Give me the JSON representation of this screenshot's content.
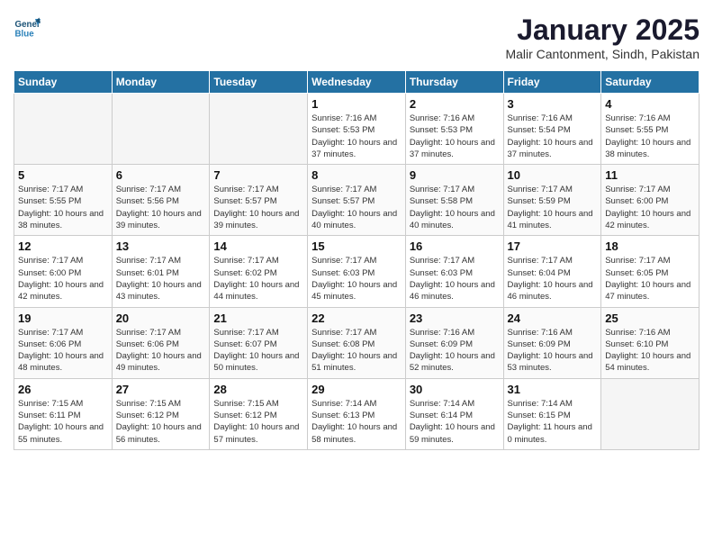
{
  "header": {
    "logo_line1": "General",
    "logo_line2": "Blue",
    "month": "January 2025",
    "location": "Malir Cantonment, Sindh, Pakistan"
  },
  "weekdays": [
    "Sunday",
    "Monday",
    "Tuesday",
    "Wednesday",
    "Thursday",
    "Friday",
    "Saturday"
  ],
  "weeks": [
    [
      {
        "day": "",
        "sunrise": "",
        "sunset": "",
        "daylight": ""
      },
      {
        "day": "",
        "sunrise": "",
        "sunset": "",
        "daylight": ""
      },
      {
        "day": "",
        "sunrise": "",
        "sunset": "",
        "daylight": ""
      },
      {
        "day": "1",
        "sunrise": "Sunrise: 7:16 AM",
        "sunset": "Sunset: 5:53 PM",
        "daylight": "Daylight: 10 hours and 37 minutes."
      },
      {
        "day": "2",
        "sunrise": "Sunrise: 7:16 AM",
        "sunset": "Sunset: 5:53 PM",
        "daylight": "Daylight: 10 hours and 37 minutes."
      },
      {
        "day": "3",
        "sunrise": "Sunrise: 7:16 AM",
        "sunset": "Sunset: 5:54 PM",
        "daylight": "Daylight: 10 hours and 37 minutes."
      },
      {
        "day": "4",
        "sunrise": "Sunrise: 7:16 AM",
        "sunset": "Sunset: 5:55 PM",
        "daylight": "Daylight: 10 hours and 38 minutes."
      }
    ],
    [
      {
        "day": "5",
        "sunrise": "Sunrise: 7:17 AM",
        "sunset": "Sunset: 5:55 PM",
        "daylight": "Daylight: 10 hours and 38 minutes."
      },
      {
        "day": "6",
        "sunrise": "Sunrise: 7:17 AM",
        "sunset": "Sunset: 5:56 PM",
        "daylight": "Daylight: 10 hours and 39 minutes."
      },
      {
        "day": "7",
        "sunrise": "Sunrise: 7:17 AM",
        "sunset": "Sunset: 5:57 PM",
        "daylight": "Daylight: 10 hours and 39 minutes."
      },
      {
        "day": "8",
        "sunrise": "Sunrise: 7:17 AM",
        "sunset": "Sunset: 5:57 PM",
        "daylight": "Daylight: 10 hours and 40 minutes."
      },
      {
        "day": "9",
        "sunrise": "Sunrise: 7:17 AM",
        "sunset": "Sunset: 5:58 PM",
        "daylight": "Daylight: 10 hours and 40 minutes."
      },
      {
        "day": "10",
        "sunrise": "Sunrise: 7:17 AM",
        "sunset": "Sunset: 5:59 PM",
        "daylight": "Daylight: 10 hours and 41 minutes."
      },
      {
        "day": "11",
        "sunrise": "Sunrise: 7:17 AM",
        "sunset": "Sunset: 6:00 PM",
        "daylight": "Daylight: 10 hours and 42 minutes."
      }
    ],
    [
      {
        "day": "12",
        "sunrise": "Sunrise: 7:17 AM",
        "sunset": "Sunset: 6:00 PM",
        "daylight": "Daylight: 10 hours and 42 minutes."
      },
      {
        "day": "13",
        "sunrise": "Sunrise: 7:17 AM",
        "sunset": "Sunset: 6:01 PM",
        "daylight": "Daylight: 10 hours and 43 minutes."
      },
      {
        "day": "14",
        "sunrise": "Sunrise: 7:17 AM",
        "sunset": "Sunset: 6:02 PM",
        "daylight": "Daylight: 10 hours and 44 minutes."
      },
      {
        "day": "15",
        "sunrise": "Sunrise: 7:17 AM",
        "sunset": "Sunset: 6:03 PM",
        "daylight": "Daylight: 10 hours and 45 minutes."
      },
      {
        "day": "16",
        "sunrise": "Sunrise: 7:17 AM",
        "sunset": "Sunset: 6:03 PM",
        "daylight": "Daylight: 10 hours and 46 minutes."
      },
      {
        "day": "17",
        "sunrise": "Sunrise: 7:17 AM",
        "sunset": "Sunset: 6:04 PM",
        "daylight": "Daylight: 10 hours and 46 minutes."
      },
      {
        "day": "18",
        "sunrise": "Sunrise: 7:17 AM",
        "sunset": "Sunset: 6:05 PM",
        "daylight": "Daylight: 10 hours and 47 minutes."
      }
    ],
    [
      {
        "day": "19",
        "sunrise": "Sunrise: 7:17 AM",
        "sunset": "Sunset: 6:06 PM",
        "daylight": "Daylight: 10 hours and 48 minutes."
      },
      {
        "day": "20",
        "sunrise": "Sunrise: 7:17 AM",
        "sunset": "Sunset: 6:06 PM",
        "daylight": "Daylight: 10 hours and 49 minutes."
      },
      {
        "day": "21",
        "sunrise": "Sunrise: 7:17 AM",
        "sunset": "Sunset: 6:07 PM",
        "daylight": "Daylight: 10 hours and 50 minutes."
      },
      {
        "day": "22",
        "sunrise": "Sunrise: 7:17 AM",
        "sunset": "Sunset: 6:08 PM",
        "daylight": "Daylight: 10 hours and 51 minutes."
      },
      {
        "day": "23",
        "sunrise": "Sunrise: 7:16 AM",
        "sunset": "Sunset: 6:09 PM",
        "daylight": "Daylight: 10 hours and 52 minutes."
      },
      {
        "day": "24",
        "sunrise": "Sunrise: 7:16 AM",
        "sunset": "Sunset: 6:09 PM",
        "daylight": "Daylight: 10 hours and 53 minutes."
      },
      {
        "day": "25",
        "sunrise": "Sunrise: 7:16 AM",
        "sunset": "Sunset: 6:10 PM",
        "daylight": "Daylight: 10 hours and 54 minutes."
      }
    ],
    [
      {
        "day": "26",
        "sunrise": "Sunrise: 7:15 AM",
        "sunset": "Sunset: 6:11 PM",
        "daylight": "Daylight: 10 hours and 55 minutes."
      },
      {
        "day": "27",
        "sunrise": "Sunrise: 7:15 AM",
        "sunset": "Sunset: 6:12 PM",
        "daylight": "Daylight: 10 hours and 56 minutes."
      },
      {
        "day": "28",
        "sunrise": "Sunrise: 7:15 AM",
        "sunset": "Sunset: 6:12 PM",
        "daylight": "Daylight: 10 hours and 57 minutes."
      },
      {
        "day": "29",
        "sunrise": "Sunrise: 7:14 AM",
        "sunset": "Sunset: 6:13 PM",
        "daylight": "Daylight: 10 hours and 58 minutes."
      },
      {
        "day": "30",
        "sunrise": "Sunrise: 7:14 AM",
        "sunset": "Sunset: 6:14 PM",
        "daylight": "Daylight: 10 hours and 59 minutes."
      },
      {
        "day": "31",
        "sunrise": "Sunrise: 7:14 AM",
        "sunset": "Sunset: 6:15 PM",
        "daylight": "Daylight: 11 hours and 0 minutes."
      },
      {
        "day": "",
        "sunrise": "",
        "sunset": "",
        "daylight": ""
      }
    ]
  ]
}
